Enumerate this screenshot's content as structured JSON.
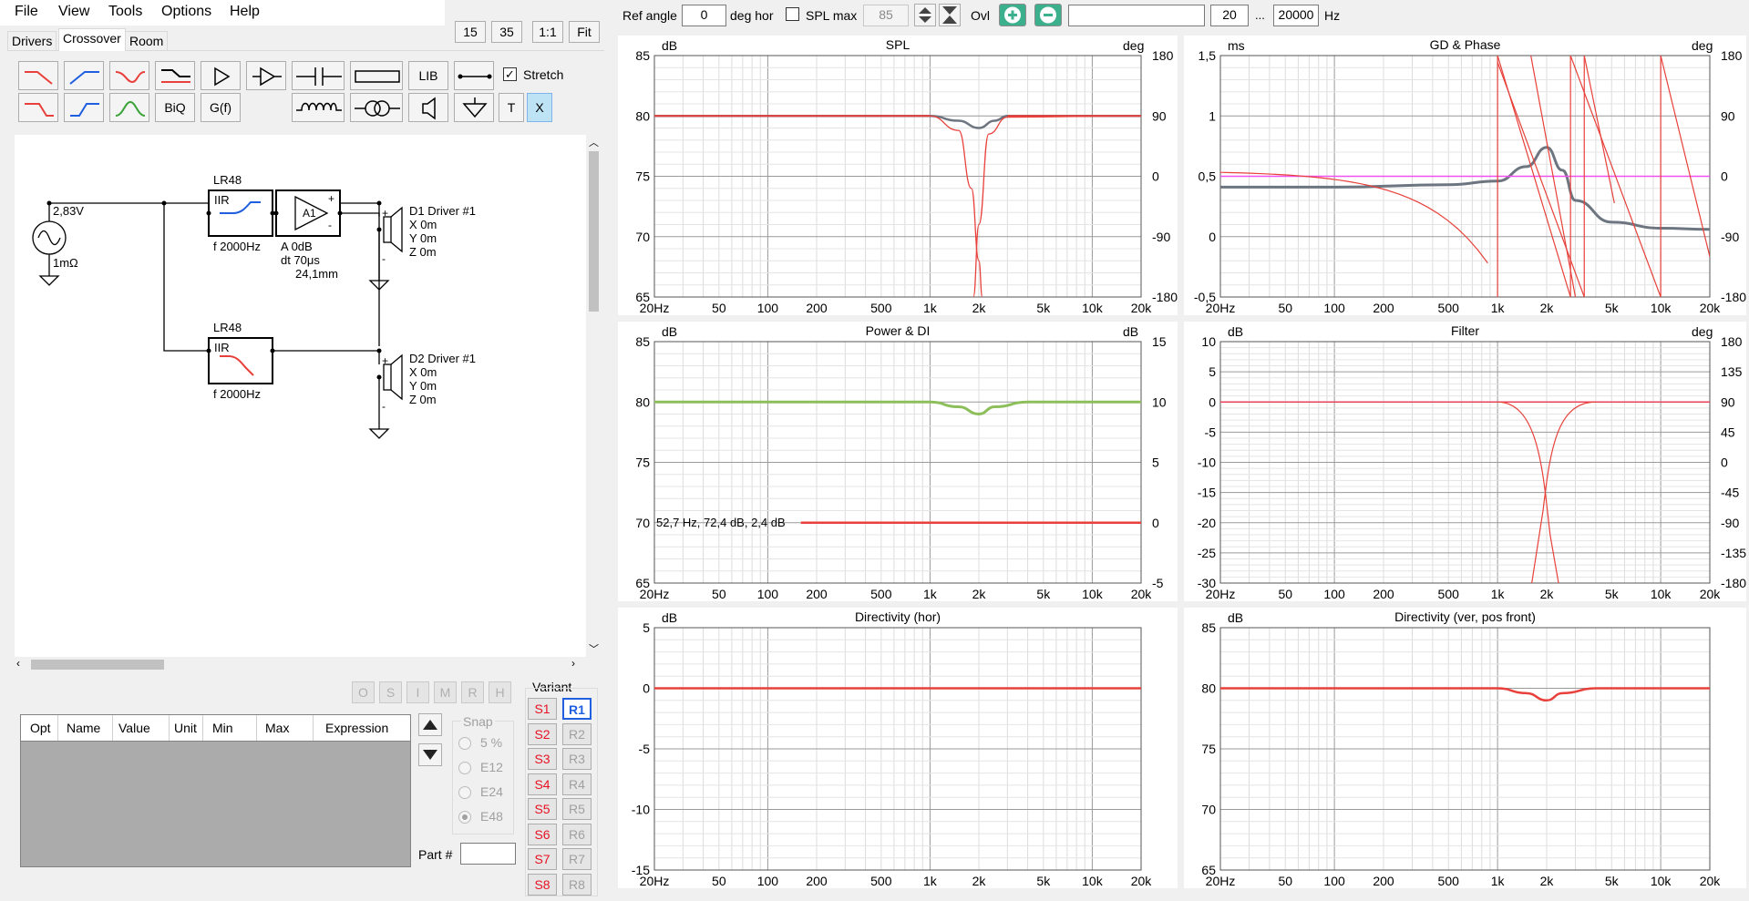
{
  "menu": [
    "File",
    "View",
    "Tools",
    "Options",
    "Help"
  ],
  "zoom_buttons": [
    "15",
    "35",
    "1:1",
    "Fit"
  ],
  "tabs": [
    "Drivers",
    "Crossover",
    "Room"
  ],
  "toolbar": {
    "lib": "LIB",
    "stretch": "Stretch",
    "biq": "BiQ",
    "gf": "G(f)",
    "t": "T",
    "x": "X"
  },
  "schematic": {
    "source_voltage": "2,83V",
    "source_impedance": "1mΩ",
    "filter1": {
      "type": "LR48",
      "kind": "IIR",
      "freq": "f  2000Hz"
    },
    "amp": {
      "name": "A1",
      "gain": "A  0dB",
      "delay": "dt 70μs",
      "distance": "24,1mm"
    },
    "driver1": {
      "name": "D1 Driver #1",
      "x": "X 0m",
      "y": "Y 0m",
      "z": "Z 0m"
    },
    "filter2": {
      "type": "LR48",
      "kind": "IIR",
      "freq": "f  2000Hz"
    },
    "driver2": {
      "name": "D2 Driver #1",
      "x": "X 0m",
      "y": "Y 0m",
      "z": "Z 0m"
    }
  },
  "opt_buttons": [
    "O",
    "S",
    "I",
    "M",
    "R",
    "H"
  ],
  "table_columns": [
    "Opt",
    "Name",
    "Value",
    "Unit",
    "Min",
    "Max",
    "Expression"
  ],
  "snap": {
    "label": "Snap",
    "options": [
      "5 %",
      "E12",
      "E24",
      "E48"
    ],
    "selected": "E48"
  },
  "part_label": "Part #",
  "variant": {
    "label": "Variant",
    "s": [
      "S1",
      "S2",
      "S3",
      "S4",
      "S5",
      "S6",
      "S7",
      "S8"
    ],
    "r": [
      "R1",
      "R2",
      "R3",
      "R4",
      "R5",
      "R6",
      "R7",
      "R8"
    ],
    "active": "R1"
  },
  "topbar": {
    "ref_angle_label": "Ref angle",
    "ref_angle_value": "0",
    "deg_hor": "deg hor",
    "spl_max_label": "SPL max",
    "spl_max_value": "85",
    "ovl": "Ovl",
    "f_min": "20",
    "ellipsis": "...",
    "f_max": "20000",
    "hz": "Hz"
  },
  "colors": {
    "red": "#e8403a",
    "blue": "#1f5fe0",
    "green": "#3aa33a",
    "gray": "#6d7580",
    "magenta": "#f050f0",
    "lime": "#8cbf5a"
  },
  "x_ticks": [
    "20Hz",
    "50",
    "100",
    "200",
    "500",
    "1k",
    "2k",
    "5k",
    "10k",
    "20k"
  ],
  "chart_data": [
    {
      "title": "SPL",
      "type": "line",
      "ylabel_left": "dB",
      "ylabel_right": "deg",
      "ylim": [
        65,
        85
      ],
      "y_ticks": [
        "85",
        "80",
        "75",
        "70",
        "65"
      ],
      "y2_ticks": [
        "180",
        "90",
        "0",
        "-90",
        "-180"
      ],
      "x_scale": "log",
      "xlim": [
        20,
        20000
      ],
      "series": [
        {
          "x": [
            20,
            1000,
            1500,
            2000,
            2500,
            3000,
            20000
          ],
          "values": [
            80,
            80,
            79.6,
            79,
            79.6,
            80,
            80
          ]
        },
        {
          "x": [
            20,
            1000,
            1500,
            1800,
            2000,
            2100
          ],
          "values": [
            80,
            80,
            78.8,
            74,
            68,
            65
          ]
        },
        {
          "x": [
            1850,
            2000,
            2300,
            3000,
            20000
          ],
          "values": [
            65,
            71,
            78.5,
            79.9,
            80
          ]
        }
      ]
    },
    {
      "title": "GD & Phase",
      "type": "line",
      "ylabel_left": "ms",
      "ylabel_right": "deg",
      "ylim": [
        -0.5,
        1.5
      ],
      "y_ticks": [
        "1,5",
        "1",
        "0,5",
        "0",
        "-0,5"
      ],
      "y2_ticks": [
        "180",
        "90",
        "0",
        "-90",
        "-180"
      ],
      "x_scale": "log",
      "xlim": [
        20,
        20000
      ],
      "series": [
        {
          "x": [
            20,
            100,
            500,
            1000,
            1500,
            2000,
            2500,
            3000,
            5000,
            10000,
            20000
          ],
          "values": [
            0.41,
            0.41,
            0.43,
            0.46,
            0.58,
            0.74,
            0.55,
            0.3,
            0.12,
            0.07,
            0.06
          ]
        }
      ]
    },
    {
      "title": "Power & DI",
      "type": "line",
      "ylabel_left": "dB",
      "ylabel_right": "dB",
      "ylim": [
        65,
        85
      ],
      "y_ticks": [
        "85",
        "80",
        "75",
        "70",
        "65"
      ],
      "y2_ticks": [
        "15",
        "10",
        "5",
        "0",
        "-5"
      ],
      "x_scale": "log",
      "xlim": [
        20,
        20000
      ],
      "annotation": "52,7 Hz, 72,4 dB, 2,4 dB",
      "series": [
        {
          "x": [
            20,
            1000,
            1500,
            2000,
            2500,
            4000,
            20000
          ],
          "values": [
            80,
            80,
            79.6,
            79,
            79.6,
            80,
            80
          ]
        }
      ]
    },
    {
      "title": "Filter",
      "type": "line",
      "ylabel_left": "dB",
      "ylabel_right": "deg",
      "ylim": [
        -30,
        10
      ],
      "y_ticks": [
        "10",
        "5",
        "0",
        "-5",
        "-10",
        "-15",
        "-20",
        "-25",
        "-30"
      ],
      "y2_ticks": [
        "180",
        "135",
        "90",
        "45",
        "0",
        "-45",
        "-90",
        "-135",
        "-180"
      ],
      "x_scale": "log",
      "xlim": [
        20,
        20000
      ],
      "series": [
        {
          "x": [
            20,
            20000
          ],
          "values": [
            0,
            0
          ]
        }
      ]
    },
    {
      "title": "Directivity (hor)",
      "type": "line",
      "ylabel_left": "dB",
      "ylim": [
        -15,
        5
      ],
      "y_ticks": [
        "5",
        "0",
        "-5",
        "-10",
        "-15"
      ],
      "x_scale": "log",
      "xlim": [
        20,
        20000
      ],
      "series": [
        {
          "x": [
            20,
            20000
          ],
          "values": [
            0,
            0
          ]
        }
      ]
    },
    {
      "title": "Directivity (ver, pos front)",
      "type": "line",
      "ylabel_left": "dB",
      "ylim": [
        65,
        85
      ],
      "y_ticks": [
        "85",
        "80",
        "75",
        "70",
        "65"
      ],
      "x_scale": "log",
      "xlim": [
        20,
        20000
      ],
      "series": [
        {
          "x": [
            20,
            1000,
            1500,
            2000,
            2500,
            4000,
            20000
          ],
          "values": [
            80,
            80,
            79.6,
            79,
            79.6,
            80,
            80
          ]
        }
      ]
    }
  ]
}
